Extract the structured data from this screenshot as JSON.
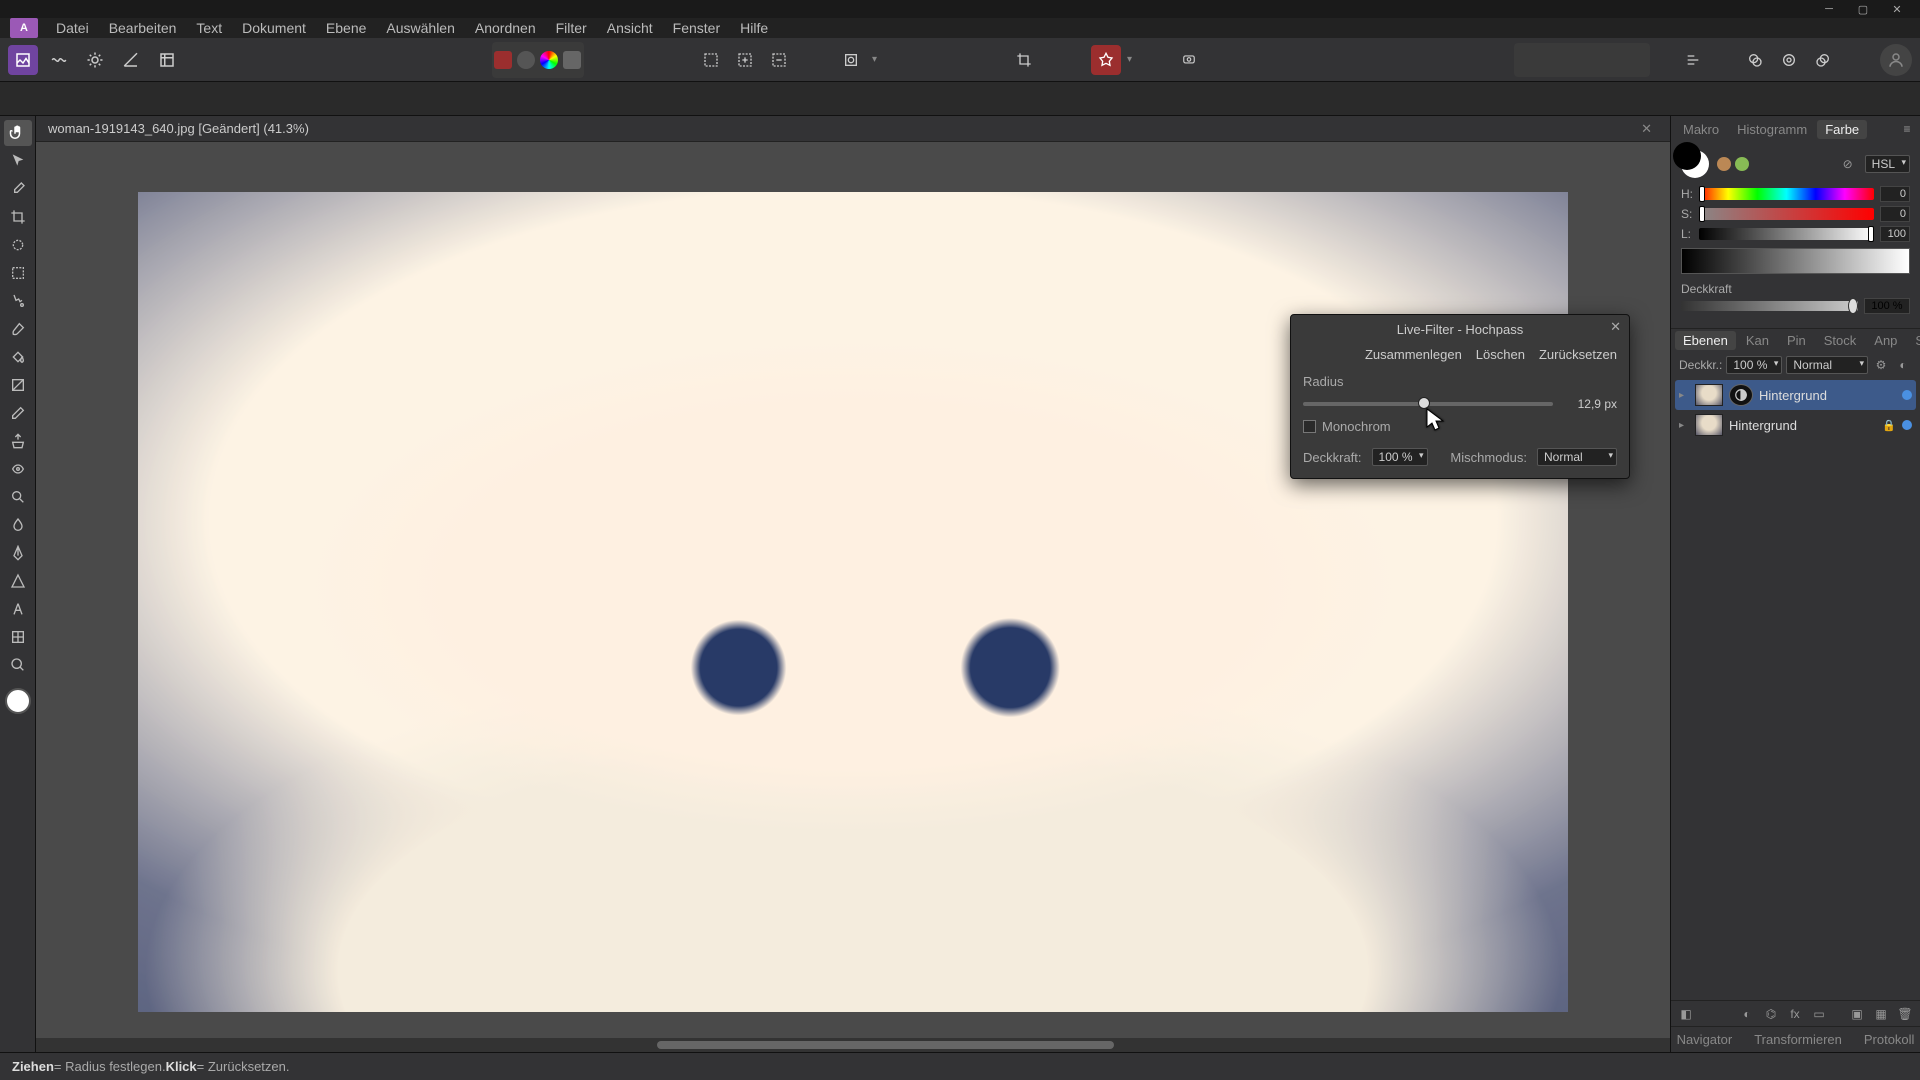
{
  "menu": {
    "logo": "A",
    "items": [
      "Datei",
      "Bearbeiten",
      "Text",
      "Dokument",
      "Ebene",
      "Auswählen",
      "Anordnen",
      "Filter",
      "Ansicht",
      "Fenster",
      "Hilfe"
    ]
  },
  "document": {
    "tab_label": "woman-1919143_640.jpg [Geändert] (41.3%)"
  },
  "dialog": {
    "title": "Live-Filter - Hochpass",
    "merge": "Zusammenlegen",
    "delete": "Löschen",
    "reset": "Zurücksetzen",
    "radius_label": "Radius",
    "radius_value": "12,9 px",
    "radius_percent": 46,
    "monochrome": "Monochrom",
    "opacity_label": "Deckkraft:",
    "opacity_value": "100 %",
    "blend_label": "Mischmodus:",
    "blend_value": "Normal"
  },
  "right": {
    "tabs_top": [
      "Makro",
      "Histogramm",
      "Farbe"
    ],
    "active_top_index": 2,
    "color_model": "HSL",
    "hsl": {
      "h_label": "H:",
      "s_label": "S:",
      "l_label": "L:",
      "h": "0",
      "s": "0",
      "l": "100"
    },
    "opacity_label": "Deckkraft",
    "opacity_value": "100 %",
    "tabs_mid": [
      "Ebenen",
      "Kan",
      "Pin",
      "Stock",
      "Anp",
      "Stile"
    ],
    "active_mid_index": 0,
    "layer_controls": {
      "opacity_label": "Deckkr.:",
      "opacity": "100 %",
      "blend": "Normal"
    },
    "layers": [
      {
        "name": "Hintergrund",
        "selected": true,
        "has_filter_mask": true
      },
      {
        "name": "Hintergrund",
        "selected": false,
        "locked": true
      }
    ],
    "tabs_bottom": [
      "Navigator",
      "Transformieren",
      "Protokoll"
    ]
  },
  "status": {
    "drag_b": "Ziehen",
    "drag_txt": " = Radius festlegen. ",
    "click_b": "Klick",
    "click_txt": " = Zurücksetzen."
  }
}
